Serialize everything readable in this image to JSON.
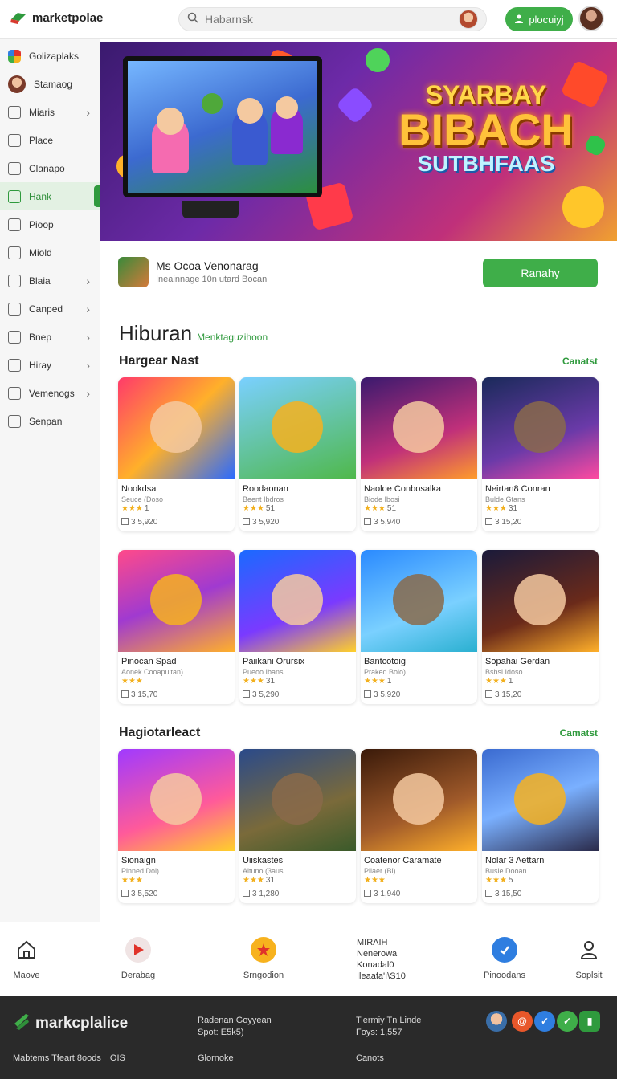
{
  "header": {
    "logo_text": "marketpolae",
    "search_placeholder": "Habarnsk",
    "user_button_label": "plocuiyj"
  },
  "sidebar": {
    "items": [
      {
        "label": "Golizaplaks",
        "icon": "app-logo-icon"
      },
      {
        "label": "Stamaog",
        "icon": "avatar-icon"
      },
      {
        "label": "Miaris",
        "icon": "book-icon",
        "chevron": true
      },
      {
        "label": "Place",
        "icon": "image-icon"
      },
      {
        "label": "Clanapo",
        "icon": "edit-icon"
      },
      {
        "label": "Hank",
        "icon": "gift-icon",
        "active": true
      },
      {
        "label": "Pioop",
        "icon": "photo-icon"
      },
      {
        "label": "Miold",
        "icon": "bag-icon"
      },
      {
        "label": "Blaia",
        "icon": "tag-icon",
        "chevron": true
      },
      {
        "label": "Canped",
        "icon": "edit-icon",
        "chevron": true
      },
      {
        "label": "Bnep",
        "icon": "mail-icon",
        "chevron": true
      },
      {
        "label": "Hiray",
        "icon": "edit-icon",
        "chevron": true
      },
      {
        "label": "Vemenogs",
        "icon": "box-icon",
        "chevron": true
      },
      {
        "label": "Senpan",
        "icon": "settings-icon"
      }
    ]
  },
  "hero": {
    "title_line1": "SYARBAY",
    "title_line2": "BIBACH",
    "title_line3": "SUTBHFAAS"
  },
  "featured": {
    "name": "Ms Ocoa Venonarag",
    "subtitle": "Ineainnage 10n utard Bocan",
    "button_label": "Ranahy"
  },
  "section": {
    "title": "Hiburan",
    "subtitle": "Menktaguzihoon"
  },
  "rows": [
    {
      "heading": "Hargear Nast",
      "more_label": "Canatst",
      "cards": [
        {
          "title": "Nookdsa",
          "sub": "Seuce (Doso",
          "stars": "★★★",
          "rating": "1",
          "price": "3 5,920"
        },
        {
          "title": "Roodaonan",
          "sub": "Beent Ibdros",
          "stars": "★★★",
          "rating": "51",
          "price": "3 5,920"
        },
        {
          "title": "Naoloe Conbosalka",
          "sub": "Biode Ibosi",
          "stars": "★★★",
          "rating": "51",
          "price": "3 5,940"
        },
        {
          "title": "Neirtan8 Conran",
          "sub": "Bulde Gtans",
          "stars": "★★★",
          "rating": "31",
          "price": "3 15,20"
        }
      ]
    },
    {
      "heading": "",
      "more_label": "",
      "cards": [
        {
          "title": "Pinocan Spad",
          "sub": "Aonek Cooapultan)",
          "stars": "★★★",
          "rating": "",
          "price": "3 15,70"
        },
        {
          "title": "Paiikani Orursix",
          "sub": "Pueoo Ibans",
          "stars": "★★★",
          "rating": "31",
          "price": "3 5,290"
        },
        {
          "title": "Bantcotoig",
          "sub": "Praked Bolo)",
          "stars": "★★★",
          "rating": "1",
          "price": "3 5,920"
        },
        {
          "title": "Sopahai Gerdan",
          "sub": "Bshsi Idoso",
          "stars": "★★★",
          "rating": "1",
          "price": "3 15,20"
        }
      ]
    },
    {
      "heading": "Hagiotarleact",
      "more_label": "Camatst",
      "cards": [
        {
          "title": "Sionaign",
          "sub": "Pinned Dol)",
          "stars": "★★★",
          "rating": "",
          "price": "3 5,520"
        },
        {
          "title": "Uiiskastes",
          "sub": "Aituno (3aus",
          "stars": "★★★",
          "rating": "31",
          "price": "3 1,280"
        },
        {
          "title": "Coatenor Caramate",
          "sub": "Pilaer (Bi)",
          "stars": "★★★",
          "rating": "",
          "price": "3 1,940"
        },
        {
          "title": "Nolar 3 Aettarn",
          "sub": "Busie Dooan",
          "stars": "★★★",
          "rating": "5",
          "price": "3 15,50"
        }
      ]
    }
  ],
  "bottom_nav": {
    "items": [
      {
        "label": "Maove",
        "icon": "home-icon"
      },
      {
        "label": "Derabag",
        "icon": "play-icon"
      },
      {
        "label": "Srngodion",
        "icon": "star-icon"
      },
      {
        "label": "Pinoodans",
        "icon": "check-icon"
      },
      {
        "label": "Soplsit",
        "icon": "user-icon"
      }
    ],
    "text_lines": [
      "MIRAIH",
      "Nenerowa",
      "Konadal0",
      "Ileaafa'ı\\S10"
    ]
  },
  "footer": {
    "logo_text": "markcplalice",
    "col1": [
      "Radenan Goyyean",
      "Spot: E5k5)"
    ],
    "col2": [
      "Tiermiy Tn Linde",
      "Foys: 1,557"
    ],
    "bottom_left": "Mabtems Tfeart 8oods",
    "bottom_left_badge": "OIS",
    "bottom_mid": "Glornoke",
    "bottom_right": "Canots"
  },
  "colors": {
    "brand_green": "#3fae49",
    "link_green": "#2f9a3d",
    "footer_bg": "#2a2a2a",
    "star": "#f2b01e"
  }
}
